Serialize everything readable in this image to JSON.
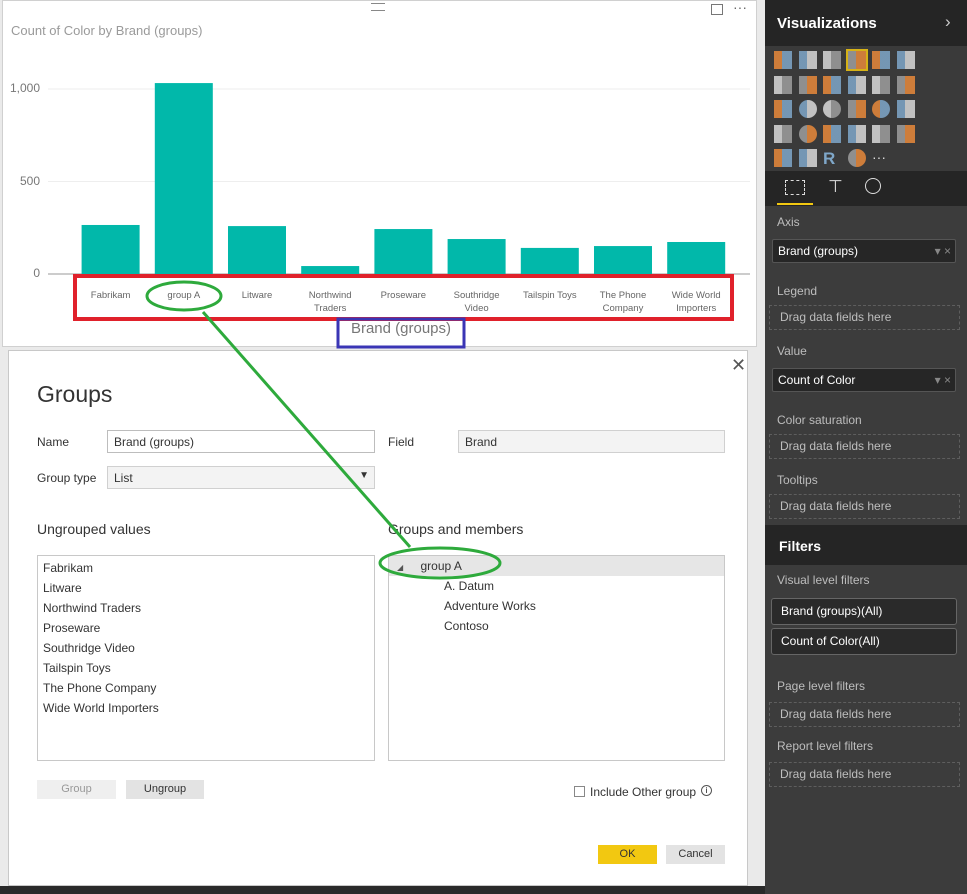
{
  "visual": {
    "title": "Count of Color by Brand (groups)",
    "axis_title": "Brand (groups)"
  },
  "chart_data": {
    "type": "bar",
    "title": "Count of Color by Brand (groups)",
    "xlabel": "Brand (groups)",
    "ylabel": "",
    "categories": [
      "Fabrikam",
      "group A",
      "Litware",
      "Northwind Traders",
      "Proseware",
      "Southridge Video",
      "Tailspin Toys",
      "The Phone Company",
      "Wide World Importers"
    ],
    "values": [
      265,
      1032,
      259,
      43,
      243,
      189,
      141,
      151,
      173
    ],
    "yticks": [
      "0",
      "500",
      "1,000"
    ],
    "ylim": [
      0,
      1000
    ],
    "grid": true,
    "color": "#01b8aa"
  },
  "dialog": {
    "title": "Groups",
    "name_label": "Name",
    "name_value": "Brand (groups)",
    "field_label": "Field",
    "field_value": "Brand",
    "group_type_label": "Group type",
    "group_type_value": "List",
    "ungrouped_label": "Ungrouped values",
    "ungrouped": [
      "Fabrikam",
      "Litware",
      "Northwind Traders",
      "Proseware",
      "Southridge Video",
      "Tailspin Toys",
      "The Phone Company",
      "Wide World Importers"
    ],
    "groups_label": "Groups and members",
    "group_name": "group A",
    "members": [
      "A. Datum",
      "Adventure Works",
      "Contoso"
    ],
    "group_button": "Group",
    "ungroup_button": "Ungroup",
    "include_other": "Include Other group",
    "ok": "OK",
    "cancel": "Cancel"
  },
  "panel": {
    "title": "Visualizations",
    "viz_icons": [
      "stacked-bar",
      "stacked-column",
      "clustered-bar",
      "clustered-column",
      "100-stacked-bar",
      "100-stacked-column",
      "line",
      "area",
      "stacked-area",
      "line-column",
      "line-clustered-column",
      "ribbon",
      "scatter",
      "pie",
      "donut",
      "treemap",
      "map",
      "filled-map",
      "funnel",
      "gauge",
      "card",
      "multi-row-card",
      "kpi",
      "slicer",
      "table",
      "matrix",
      "r-visual",
      "globe",
      "more"
    ],
    "axis_label": "Axis",
    "axis_value": "Brand (groups)",
    "legend_label": "Legend",
    "drag": "Drag data fields here",
    "value_label": "Value",
    "value_value": "Count of Color",
    "saturation_label": "Color saturation",
    "tooltips_label": "Tooltips",
    "filters_title": "Filters",
    "visual_filters_label": "Visual level filters",
    "filters": [
      "Brand (groups)(All)",
      "Count of Color(All)"
    ],
    "page_filters_label": "Page level filters",
    "report_filters_label": "Report level filters"
  },
  "colors": {
    "bar": "#01b8aa",
    "ok": "#f2c811",
    "annotation_red": "#e0212b",
    "annotation_blue": "#3a35b5",
    "annotation_green": "#2eaa3c"
  }
}
